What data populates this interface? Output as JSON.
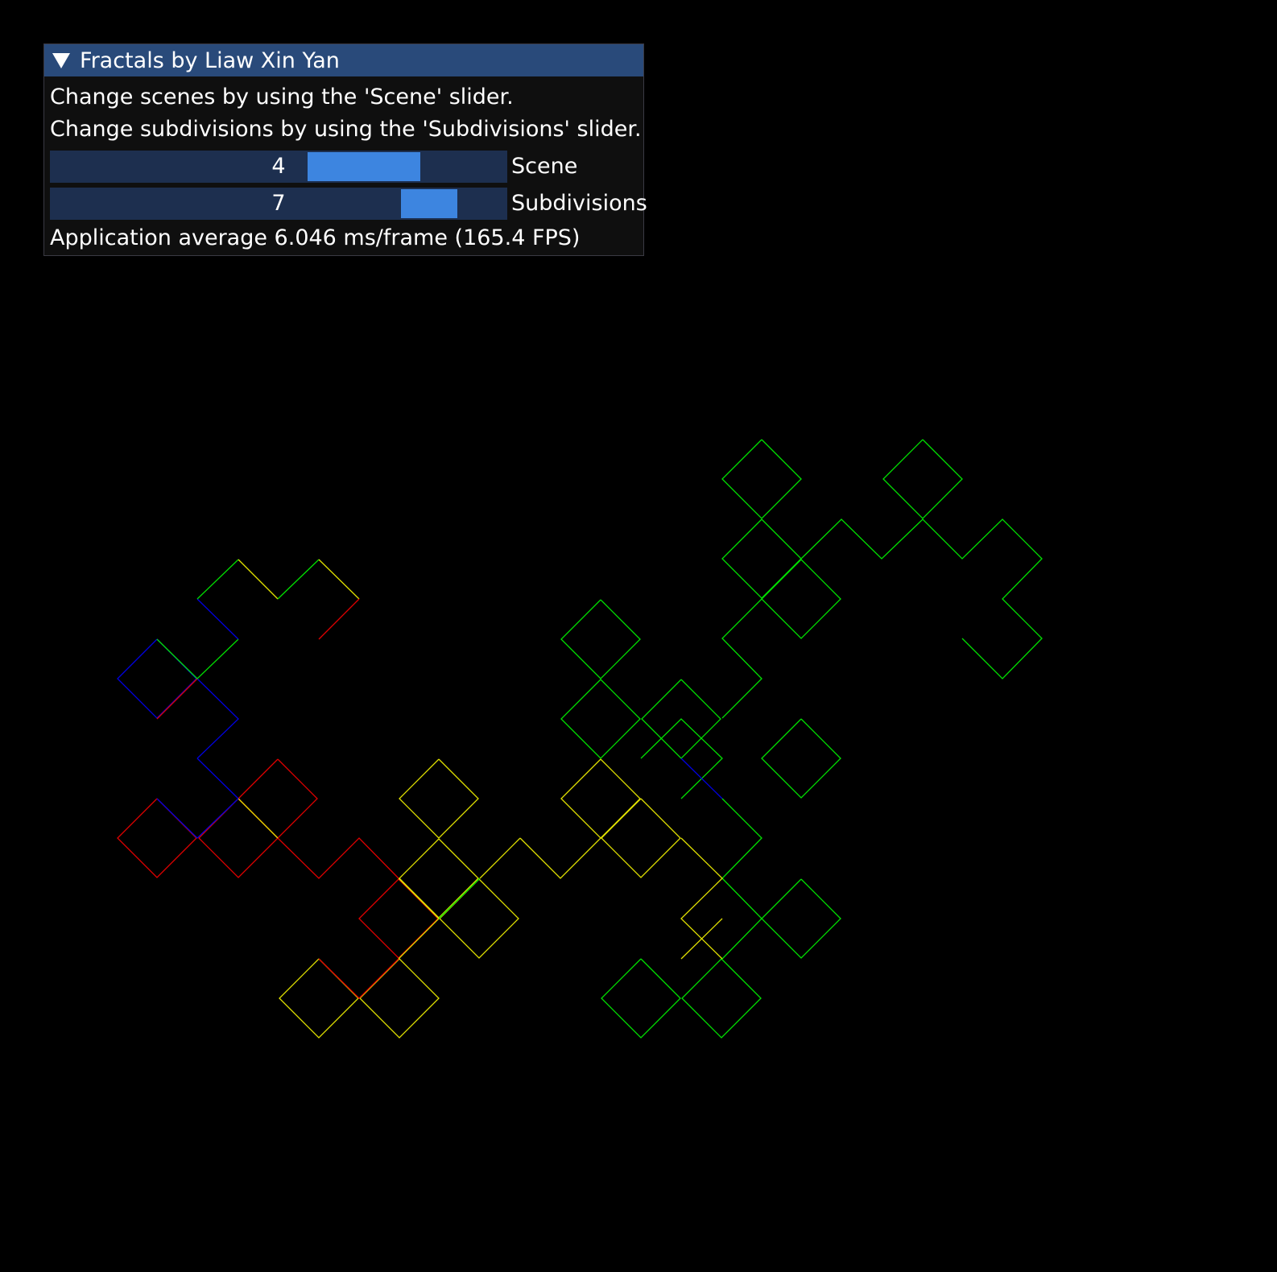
{
  "window": {
    "title": "Fractals by Liaw Xin Yan",
    "line1": "Change scenes by using the 'Scene' slider.",
    "line2": "Change subdivisions by using the 'Subdivisions' slider.",
    "scene": {
      "label": "Scene",
      "value": "4",
      "fraction": 0.75
    },
    "subdivisions": {
      "label": "Subdivisions",
      "value": "7",
      "fraction": 0.88
    },
    "stats": "Application average 6.046 ms/frame (165.4 FPS)"
  },
  "colors": {
    "panel_bg": "#0f0f0f",
    "title_bg": "#294a7a",
    "slider_bg": "#1d2f4f",
    "slider_grab": "#3d85e0",
    "green": "#00e000",
    "yellow": "#e0e000",
    "red": "#e00000",
    "blue": "#0000e0"
  }
}
